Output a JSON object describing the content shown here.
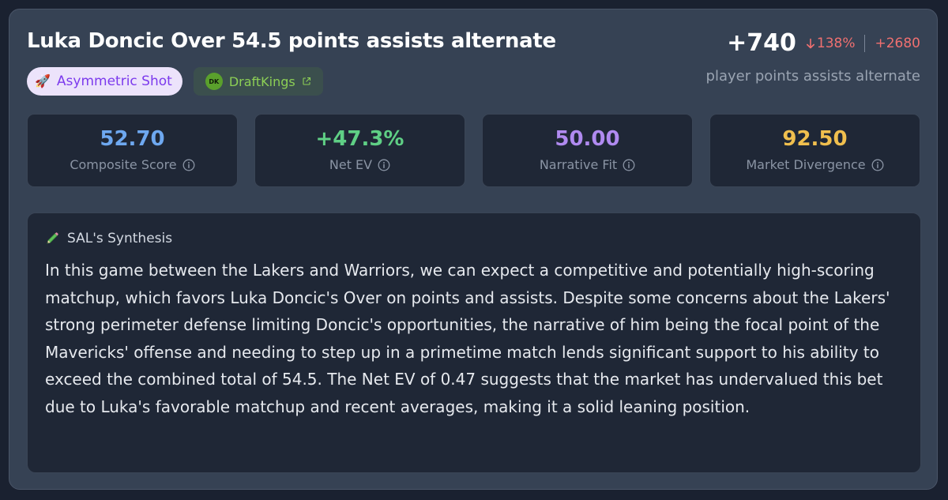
{
  "bet": {
    "title": "Luka Doncic Over 54.5 points assists alternate",
    "badge_type": "Asymmetric Shot",
    "badge_type_icon": "rocket-icon",
    "sportsbook": "DraftKings",
    "sportsbook_logo": "DK"
  },
  "odds": {
    "current": "+740",
    "change": "138%",
    "change_direction": "down",
    "previous": "+2680",
    "market": "player points assists alternate"
  },
  "metrics": [
    {
      "value": "52.70",
      "label": "Composite Score",
      "color": "#6ea8f0"
    },
    {
      "value": "+47.3%",
      "label": "Net EV",
      "color": "#5fcf85"
    },
    {
      "value": "50.00",
      "label": "Narrative Fit",
      "color": "#b08af0"
    },
    {
      "value": "92.50",
      "label": "Market Divergence",
      "color": "#f0bf4e"
    }
  ],
  "synthesis": {
    "heading": "SAL's Synthesis",
    "icon": "pencil-icon",
    "body": "In this game between the Lakers and Warriors, we can expect a competitive and potentially high-scoring matchup, which favors Luka Doncic's Over on points and assists. Despite some concerns about the Lakers' strong perimeter defense limiting Doncic's opportunities, the narrative of him being the focal point of the Mavericks' offense and needing to step up in a primetime match lends significant support to his ability to exceed the combined total of 54.5. The Net EV of 0.47 suggests that the market has undervalued this bet due to Luka's favorable matchup and recent averages, making it a solid leaning position."
  },
  "colors": {
    "card_bg": "#364254",
    "panel_bg": "#1f2736",
    "odds_change": "#f07070",
    "badge_type_bg": "#ece3fb",
    "badge_type_text": "#7c3aed",
    "sportsbook_text": "#8ccf55"
  }
}
